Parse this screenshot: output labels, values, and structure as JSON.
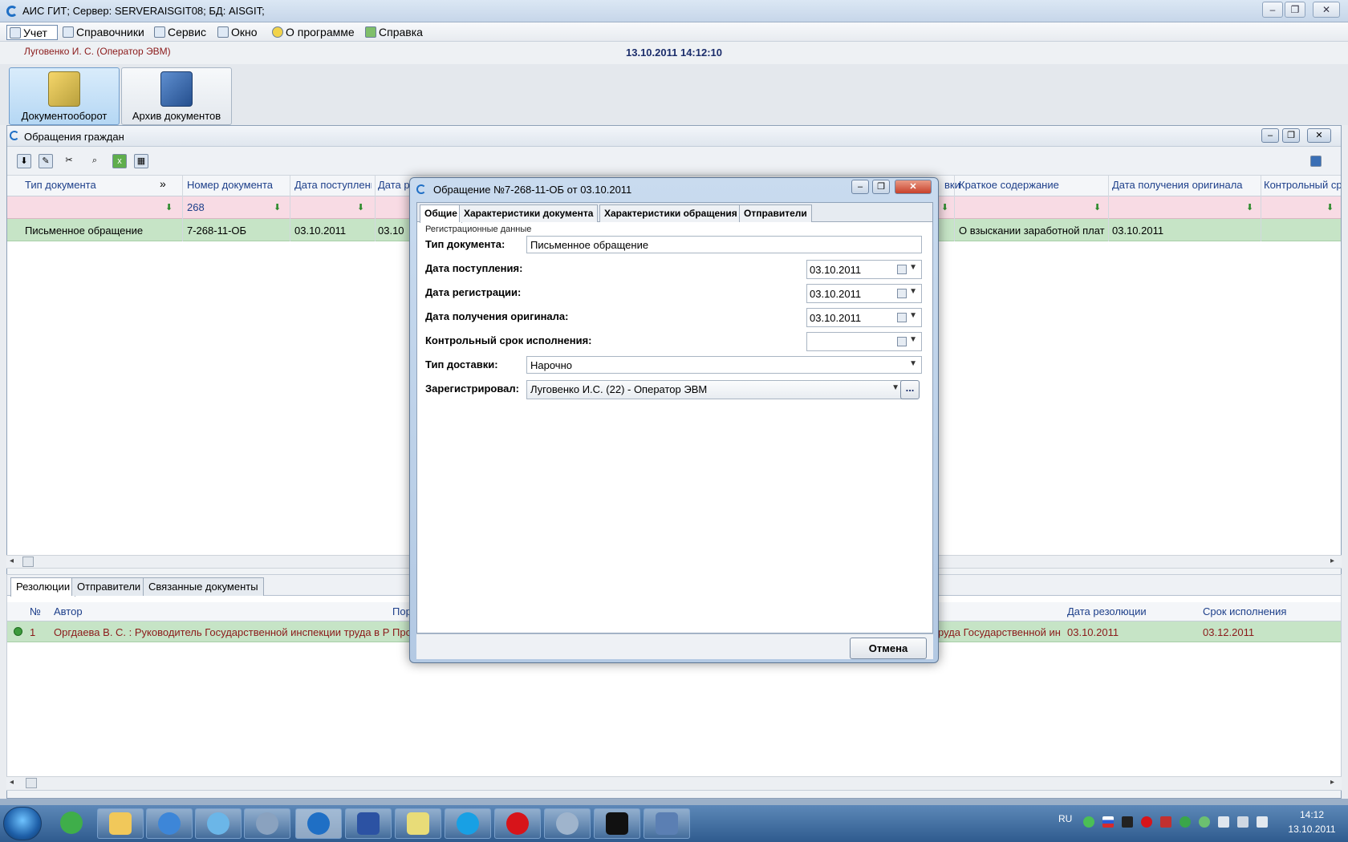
{
  "app": {
    "title": "АИС ГИТ;  Сервер: SERVERAISGIT08;   БД: AISGIT;",
    "minimize": "–",
    "maximize": "❐",
    "close": "✕"
  },
  "menu": {
    "items": [
      "Учет",
      "Справочники",
      "Сервис",
      "Окно",
      "О программе",
      "Справка"
    ]
  },
  "user": {
    "name": "Луговенко И. С. (Оператор ЭВМ)",
    "datetime": "13.10.2011  14:12:10"
  },
  "launcher": {
    "buttons": [
      "Документооборот",
      "Архив документов"
    ]
  },
  "child_window": {
    "title": "Обращения граждан",
    "toolbar_icons": [
      "import-icon",
      "edit-icon",
      "cut-icon",
      "search-icon",
      "excel-icon",
      "calculator-icon"
    ],
    "grid": {
      "headers": [
        "Тип документа",
        "Номер документа",
        "Дата поступлени",
        "Дата р",
        "вки",
        "Краткое содержание",
        "Дата получения оригинала",
        "Контрольный ср"
      ],
      "filter_value": "268",
      "row": {
        "type": "Письменное обращение",
        "number": "7-268-11-ОБ",
        "date_in": "03.10.2011",
        "date_reg": "03.10",
        "summary": "О взыскании заработной плат",
        "date_original": "03.10.2011"
      }
    }
  },
  "bottom": {
    "tabs": [
      "Резолюции",
      "Отправители",
      "Связанные документы"
    ],
    "headers": [
      "№",
      "Автор",
      "Пор",
      "Дата резолюции",
      "Срок исполнения"
    ],
    "row": {
      "num": "1",
      "author": "Оргдаева В. С. : Руководитель Государственной инспекции труда в Р",
      "por": "Про",
      "tail": "руда Государственной ин",
      "date_res": "03.10.2011",
      "deadline": "03.12.2011"
    }
  },
  "dialog": {
    "title": "Обращение №7-268-11-ОБ от 03.10.2011",
    "tabs": [
      "Общие",
      "Характеристики документа",
      "Характеристики обращения",
      "Отправители"
    ],
    "group_label": "Регистрационные данные",
    "fields": {
      "doc_type_label": "Тип документа:",
      "doc_type_value": "Письменное обращение",
      "date_in_label": "Дата поступления:",
      "date_in_value": "03.10.2011",
      "date_reg_label": "Дата регистрации:",
      "date_reg_value": "03.10.2011",
      "date_orig_label": "Дата получения оригинала:",
      "date_orig_value": "03.10.2011",
      "deadline_label": "Контрольный срок исполнения:",
      "deadline_value": "",
      "delivery_label": "Тип доставки:",
      "delivery_value": "Нарочно",
      "registered_by_label": "Зарегистрировал:",
      "registered_by_value": "Луговенко И.С. (22) - Оператор ЭВМ",
      "ellipsis": "..."
    },
    "cancel": "Отмена"
  },
  "taskbar": {
    "language": "RU",
    "time": "14:12",
    "date": "13.10.2011"
  }
}
